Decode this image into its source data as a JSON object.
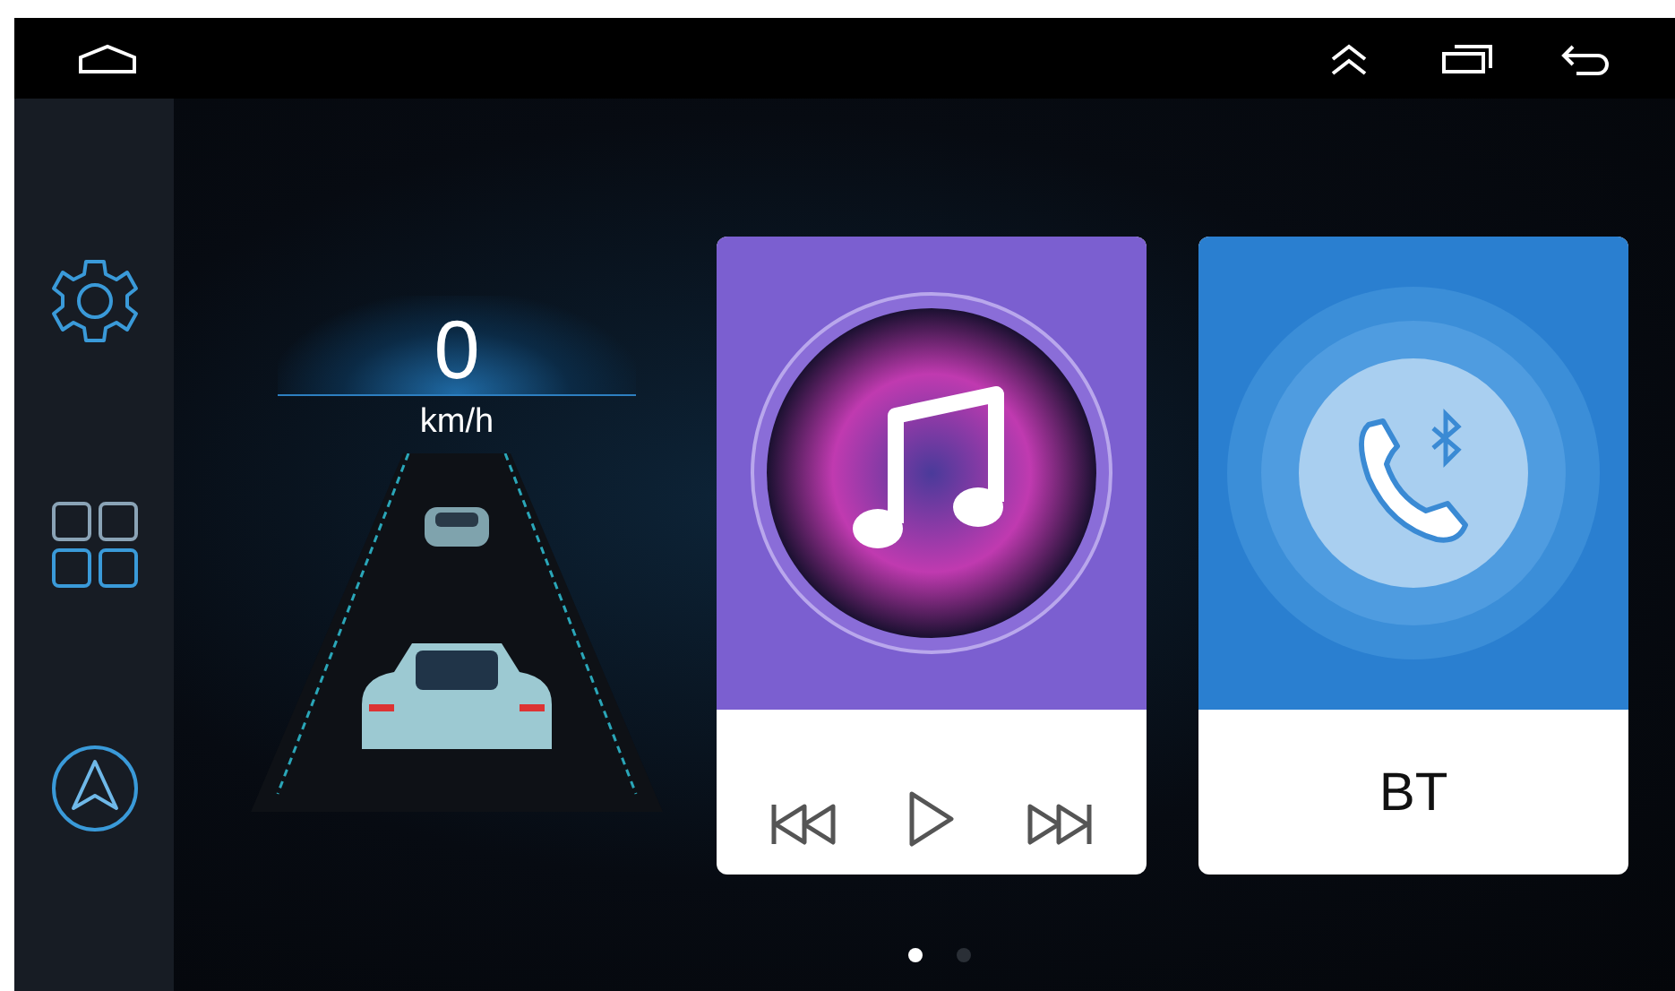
{
  "speedometer": {
    "value": "0",
    "unit": "km/h"
  },
  "cards": [
    {
      "kind": "music"
    },
    {
      "kind": "phone",
      "label": "BT"
    }
  ],
  "pager": [
    {
      "selected": true
    },
    {
      "selected": false
    }
  ]
}
